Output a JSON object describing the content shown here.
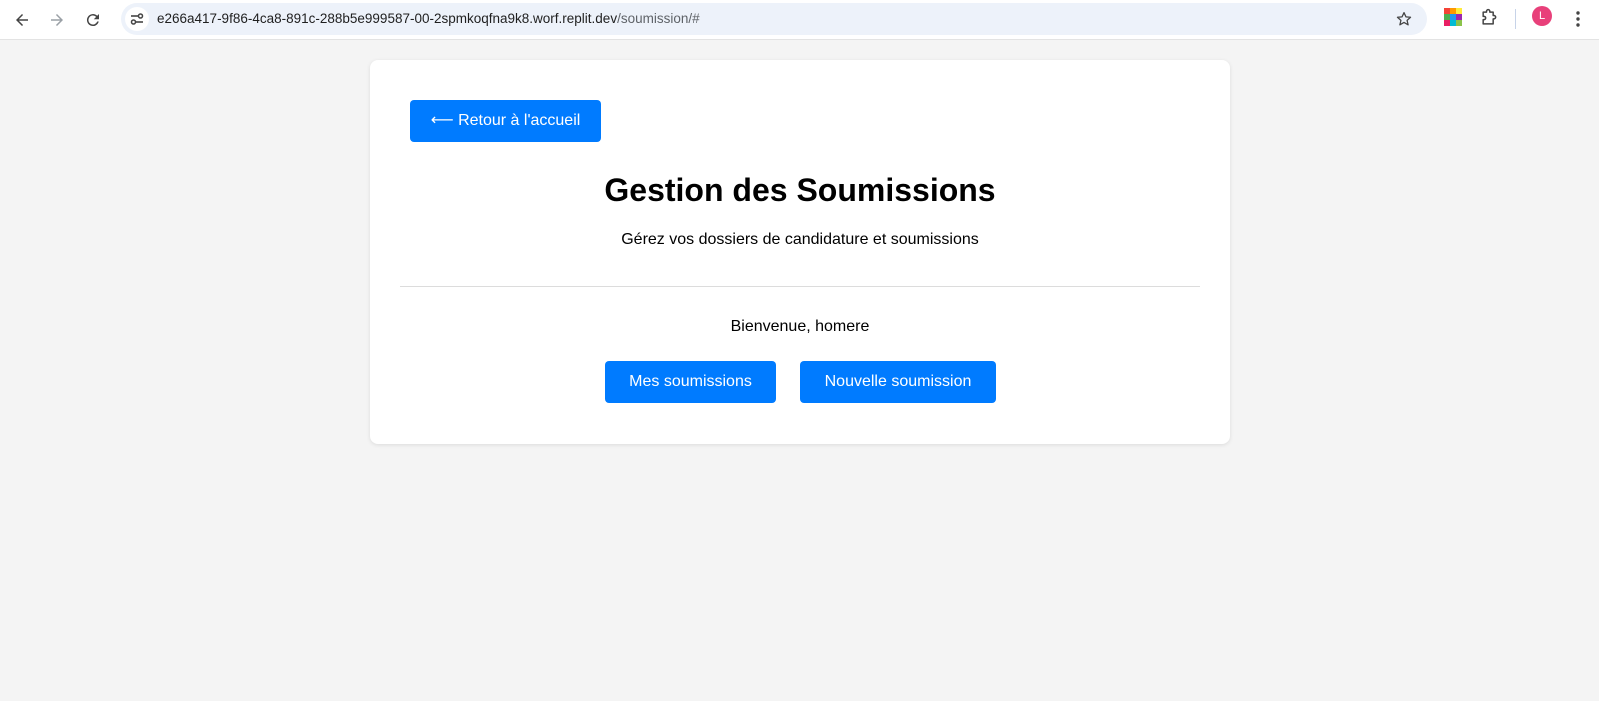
{
  "browser": {
    "url_host": "e266a417-9f86-4ca8-891c-288b5e999587-00-2spmkoqfna9k8.worf.replit.dev",
    "url_path": "/soumission/#",
    "profile_initial": "L",
    "icons": [
      "back-arrow-icon",
      "forward-arrow-icon",
      "reload-icon",
      "site-settings-icon",
      "bookmark-star-icon",
      "color-extension-icon",
      "puzzle-extensions-icon",
      "profile-avatar",
      "kebab-menu-icon"
    ]
  },
  "page": {
    "back_label": "⟵ Retour à l'accueil",
    "title": "Gestion des Soumissions",
    "subtitle": "Gérez vos dossiers de candidature et soumissions",
    "welcome": "Bienvenue, homere",
    "my_submissions_label": "Mes soumissions",
    "new_submission_label": "Nouvelle soumission"
  },
  "colors": {
    "accent": "#007bff",
    "background": "#f4f4f4",
    "card": "#ffffff"
  }
}
